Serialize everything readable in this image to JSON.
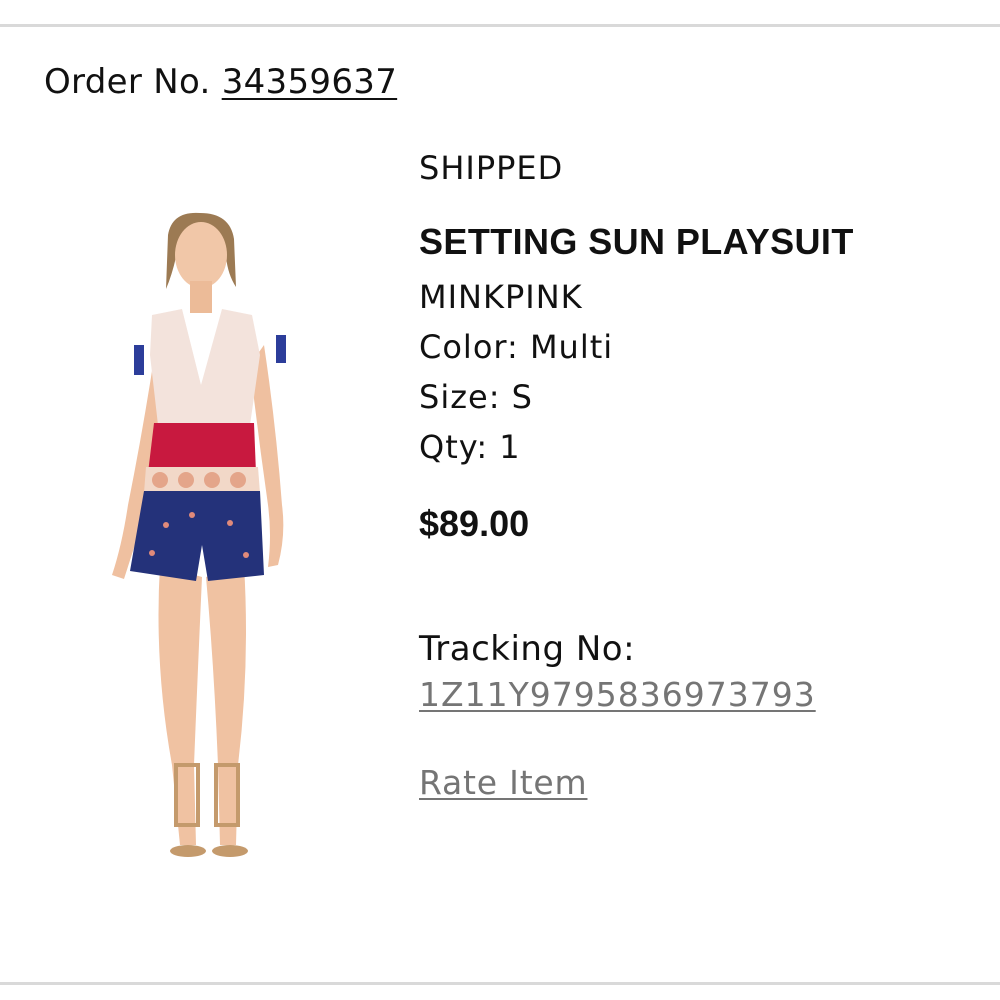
{
  "order": {
    "label": "Order No.",
    "number": "34359637"
  },
  "item": {
    "status": "SHIPPED",
    "name": "SETTING SUN PLAYSUIT",
    "brand": "MINKPINK",
    "color": "Color: Multi",
    "size": "Size: S",
    "qty": "Qty: 1",
    "price": "$89.00",
    "tracking_label": "Tracking No:",
    "tracking_number": "1Z11Y97958369737​93",
    "rate_label": "Rate Item"
  },
  "colors": {
    "divider": "#d9d9d9",
    "text": "#111111",
    "link_muted": "#757575",
    "garment_top": "#f3e3dc",
    "garment_band": "#c8193f",
    "garment_shorts": "#24327a"
  }
}
